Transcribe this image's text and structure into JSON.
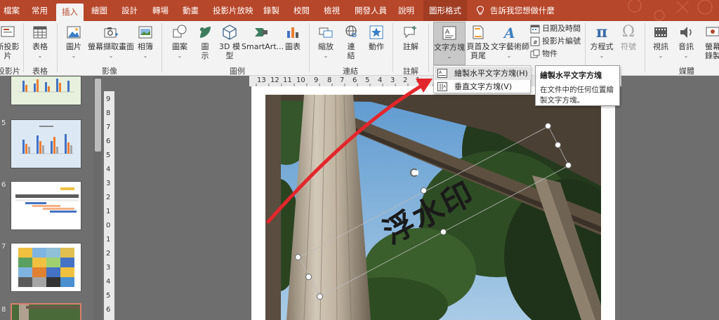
{
  "tabs": [
    {
      "label": "檔案"
    },
    {
      "label": "常用"
    },
    {
      "label": "插入",
      "active": true
    },
    {
      "label": "繪圖"
    },
    {
      "label": "設計"
    },
    {
      "label": "轉場"
    },
    {
      "label": "動畫"
    },
    {
      "label": "投影片放映"
    },
    {
      "label": "錄製"
    },
    {
      "label": "校閱"
    },
    {
      "label": "檢視"
    },
    {
      "label": "開發人員"
    },
    {
      "label": "說明"
    },
    {
      "label": "圖形格式"
    }
  ],
  "tell_me": "告訴我您想做什麼",
  "ribbon": {
    "slides": {
      "label_top": "新投影",
      "label_bottom": "片",
      "group": "投影片"
    },
    "table": {
      "label": "表格",
      "group": "表格"
    },
    "images": {
      "pictures": "圖片",
      "screenshot": "螢幕擷取畫面",
      "album": "相簿",
      "group": "影像"
    },
    "illustrations": {
      "shapes": "圖案",
      "icons_top": "圖",
      "icons_bottom": "示",
      "models_top": "3D 模",
      "models_bottom": "型",
      "smartart": "SmartArt...",
      "chart": "圖表",
      "group": "圖例"
    },
    "links": {
      "zoom": "縮放",
      "link_top": "連",
      "link_bottom": "結",
      "action": "動作",
      "group": "連結"
    },
    "comments": {
      "label": "註解",
      "group": "註解"
    },
    "text": {
      "textbox": "文字方塊",
      "header_top": "頁首及",
      "header_bottom": "頁尾",
      "wordart": "文字藝術師",
      "datetime": "日期及時間",
      "slide_number": "投影片編號",
      "object": "物件"
    },
    "symbols": {
      "equation": "方程式",
      "symbol": "符號"
    },
    "media": {
      "video": "視訊",
      "audio": "音訊",
      "screen_record_top": "螢幕",
      "screen_record_bottom": "錄製",
      "group": "媒體"
    }
  },
  "dropdown": {
    "items": [
      {
        "label": "繪製水平文字方塊(H)"
      },
      {
        "label": "垂直文字方塊(V)"
      }
    ]
  },
  "tooltip": {
    "title": "繪製水平文字方塊",
    "body": "在文件中的任何位置繪製文字方塊。"
  },
  "ruler": {
    "h_ticks": [
      "13",
      "12",
      "11",
      "10",
      "9",
      "8",
      "7",
      "6",
      "5",
      "4",
      "3",
      "2",
      "1"
    ],
    "v_ticks": [
      "9",
      "8",
      "7",
      "6",
      "5",
      "4",
      "3",
      "2",
      "1",
      "0",
      "1",
      "2",
      "3",
      "4",
      "5",
      "6"
    ]
  },
  "slide_panel": {
    "numbers": [
      "5",
      "6",
      "7",
      "8"
    ]
  },
  "slide": {
    "watermark_text": "浮水印"
  },
  "colors": {
    "accent": "#b7472a",
    "ribbon_bg": "#f3f3f3",
    "arrow": "#e3262b",
    "workspace": "#6e6e6e"
  }
}
